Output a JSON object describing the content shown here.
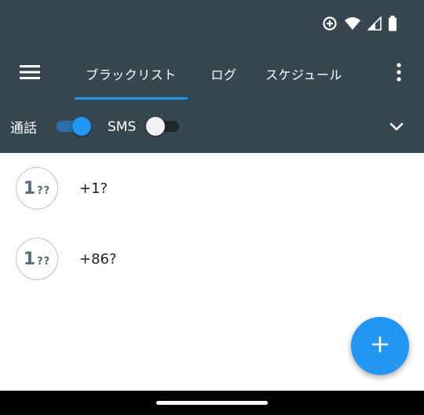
{
  "colors": {
    "toolbar": "#37474f",
    "accent": "#2196f3",
    "avatar_text": "#546e7a",
    "item_text": "#212121",
    "nav_bar": "#000000"
  },
  "status_bar": {
    "icons": [
      "data-saver-icon",
      "wifi-icon",
      "cellular-signal-icon",
      "battery-icon"
    ]
  },
  "app_bar": {
    "menu_icon": "hamburger-menu-icon",
    "tabs": [
      {
        "label": "ブラックリスト",
        "selected": true
      },
      {
        "label": "ログ",
        "selected": false
      },
      {
        "label": "スケジュール",
        "selected": false
      }
    ],
    "overflow_icon": "more-vertical-icon"
  },
  "filters": {
    "call": {
      "label": "通話",
      "on": true
    },
    "sms": {
      "label": "SMS",
      "on": false
    },
    "expand_icon": "chevron-down-icon"
  },
  "list": [
    {
      "avatar_big": "1",
      "avatar_small": "??",
      "number": "+1?"
    },
    {
      "avatar_big": "1",
      "avatar_small": "??",
      "number": "+86?"
    }
  ],
  "fab": {
    "icon": "plus-icon"
  }
}
